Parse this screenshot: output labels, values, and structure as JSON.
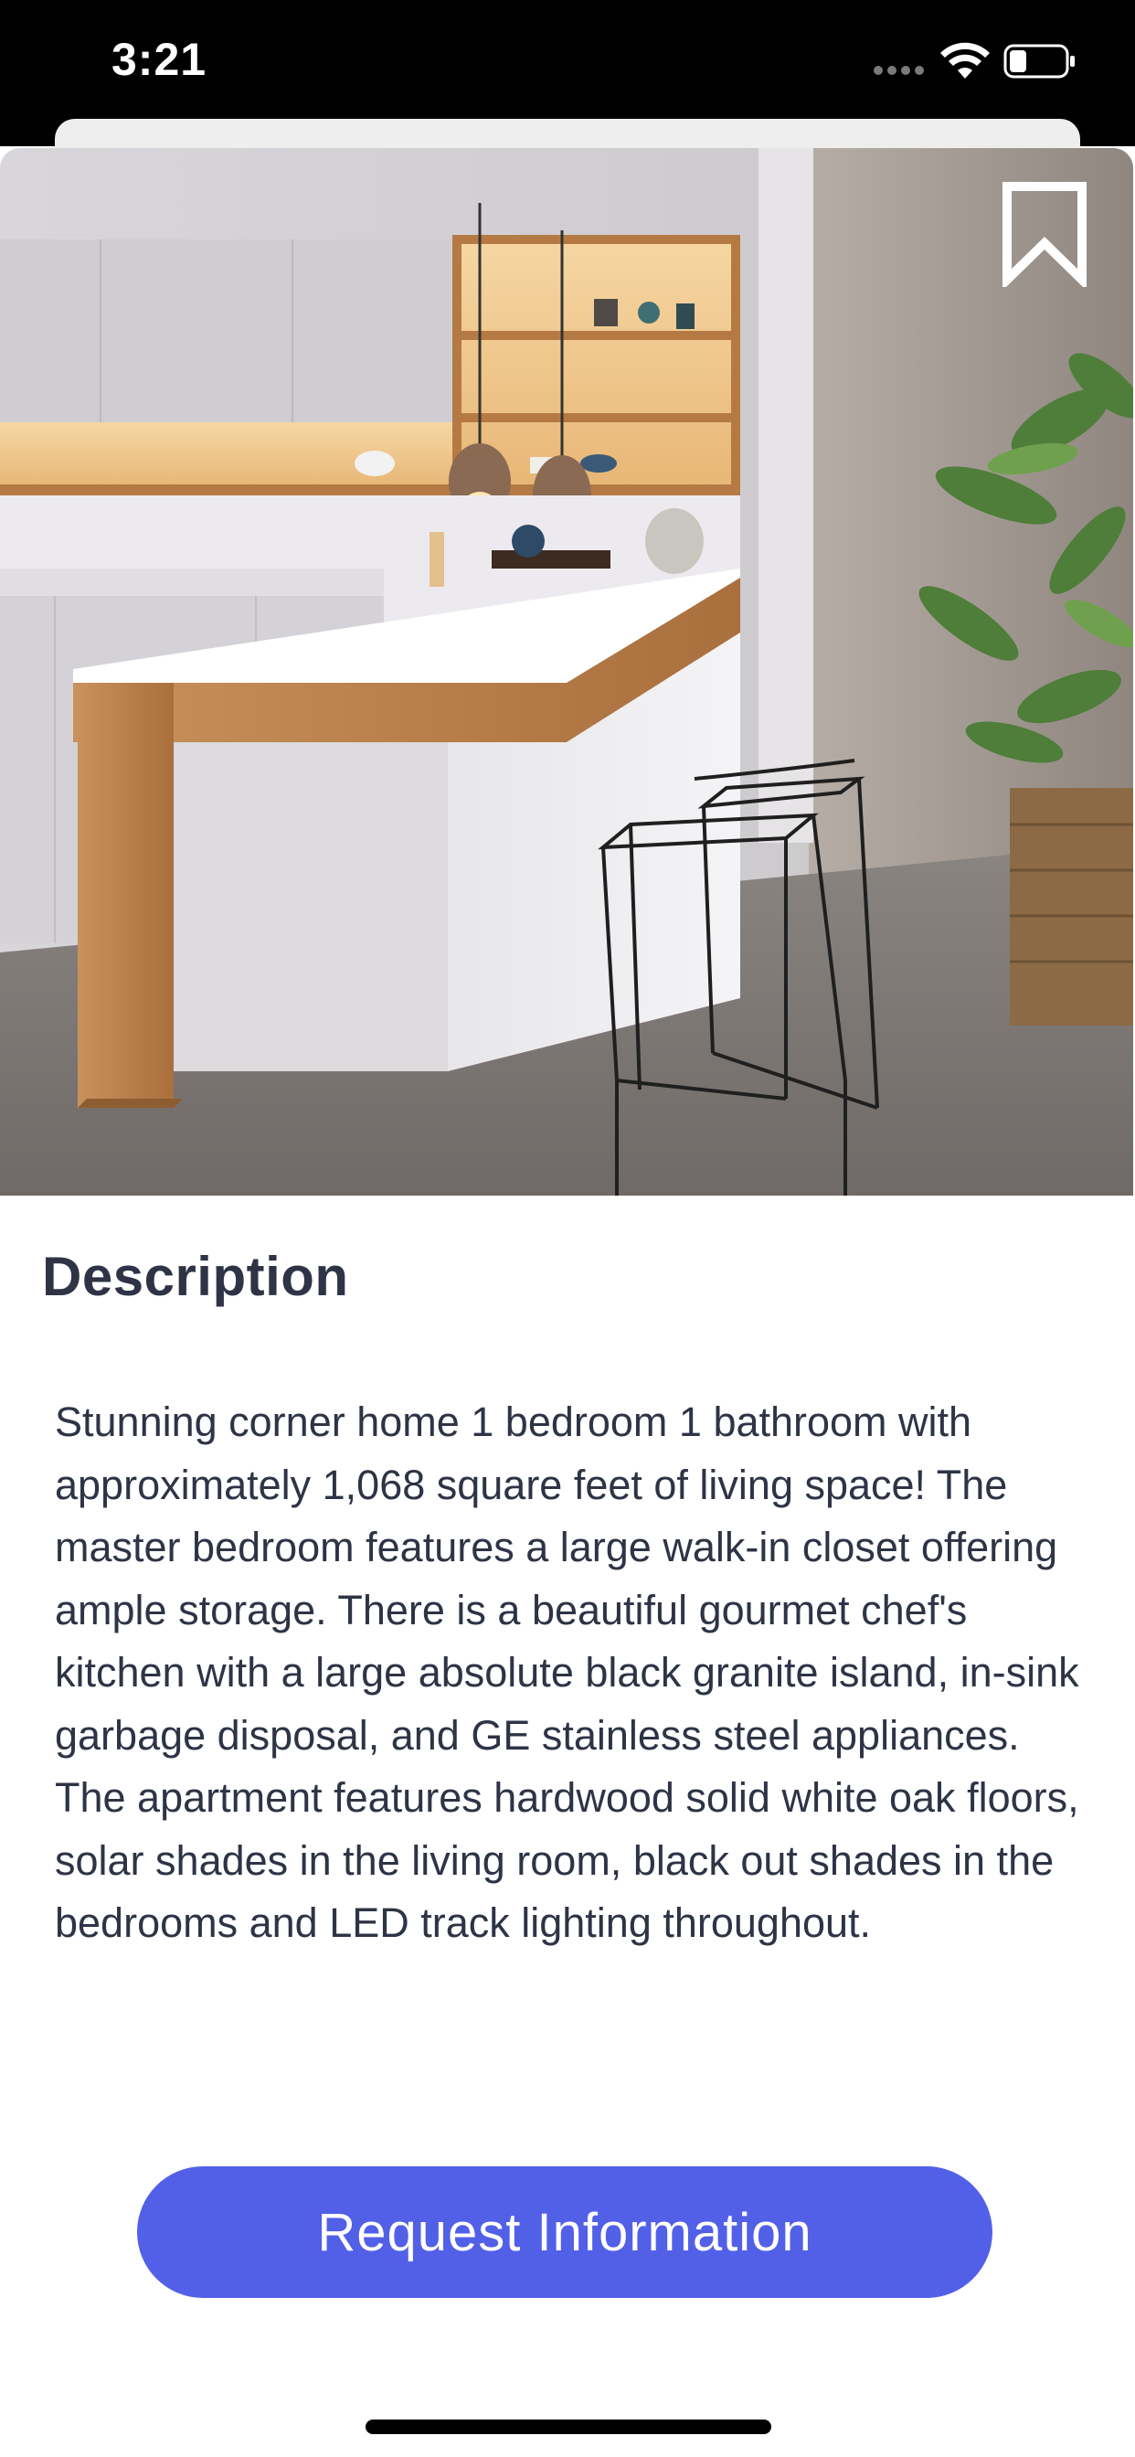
{
  "status_bar": {
    "time": "3:21"
  },
  "listing": {
    "image_alt": "Modern white kitchen with wooden island counter and black wire bar stools",
    "bookmark_icon": "bookmark-outline-icon",
    "description_title": "Description",
    "description_text": "Stunning corner home 1 bedroom 1 bathroom with approximately 1,068 square feet of living space! The master bedroom features a large walk-in closet offering ample storage. There is a beautiful gourmet chef's kitchen with a large absolute black granite island, in-sink garbage disposal, and GE stainless steel appliances. The apartment features hardwood solid white oak floors, solar shades in the living room, black out shades in the bedrooms and LED track lighting throughout.",
    "request_button_label": "Request Information"
  },
  "colors": {
    "accent": "#5260e8",
    "text": "#2e3446",
    "status_bar": "#000000"
  }
}
